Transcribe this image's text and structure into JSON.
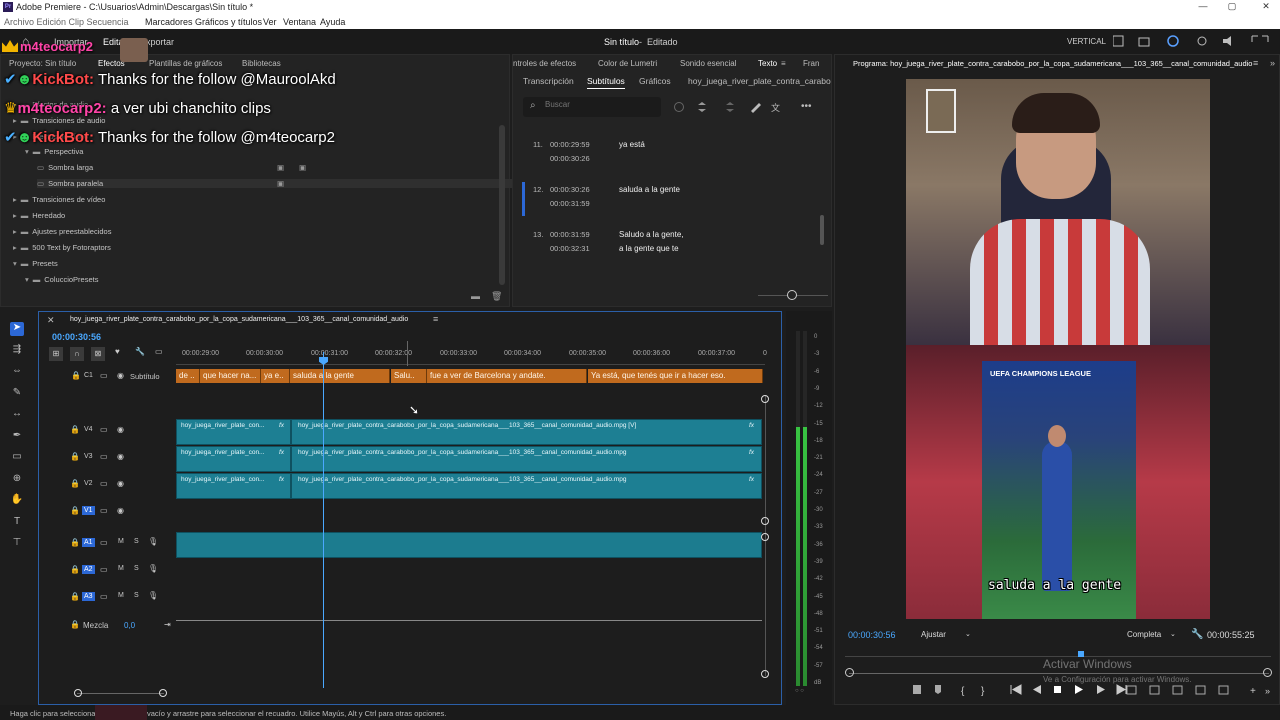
{
  "window": {
    "title": "Adobe Premiere - C:\\Usuarios\\Admin\\Descargas\\Sin título *",
    "min": "—",
    "max": "▢",
    "close": "✕"
  },
  "menu": [
    "Marcadores",
    "Gráficos y títulos",
    "Ver",
    "Ventana",
    "Ayuda"
  ],
  "menu_partial": "Archivo  Edición  Clip  Secuencia",
  "appbar": {
    "home": "⌂",
    "importar": "Importar",
    "editar": "Editar",
    "exportar": "Exportar",
    "project_title": "Sin título",
    "project_mode": "Editado",
    "vertical": "VERTICAL"
  },
  "overlay": {
    "top_user": "m4teocarp2",
    "lines": [
      {
        "user": "KickBot:",
        "text": " Thanks for the follow @MauroolAkd"
      },
      {
        "user": "m4teocarp2:",
        "text": " a ver ubi chanchito clips"
      },
      {
        "user": "KickBot:",
        "text": " Thanks for the follow @m4teocarp2"
      }
    ]
  },
  "left_panel": {
    "tabs": [
      "Proyecto: Sin título",
      "Efectos",
      "Plantillas de gráficos",
      "Bibliotecas"
    ],
    "tree": [
      {
        "label": "Efectos de audio",
        "indent": 0
      },
      {
        "label": "Transiciones de audio",
        "indent": 0
      },
      {
        "label": "Efectos de vídeo",
        "indent": 0
      },
      {
        "label": "Perspectiva",
        "indent": 1
      },
      {
        "label": "Sombra larga",
        "indent": 2
      },
      {
        "label": "Sombra paralela",
        "indent": 2
      },
      {
        "label": "Transiciones de vídeo",
        "indent": 0
      },
      {
        "label": "Heredado",
        "indent": 0
      },
      {
        "label": "Ajustes preestablecidos",
        "indent": 0
      },
      {
        "label": "500 Text by Fotoraptors",
        "indent": 0
      },
      {
        "label": "Presets",
        "indent": 0
      },
      {
        "label": "ColuccioPresets",
        "indent": 1
      }
    ]
  },
  "mid_panel": {
    "tabs_top": [
      "ntroles de efectos",
      "Color de Lumetri",
      "Sonido esencial",
      "Texto",
      "Fran"
    ],
    "tabs_sub": [
      "Transcripción",
      "Subtítulos",
      "Gráficos",
      "hoy_juega_river_plate_contra_carabo"
    ],
    "search_placeholder": "Buscar",
    "captions": [
      {
        "num": "11.",
        "start": "00:00:29:59",
        "end": "00:00:30:26",
        "text1": "ya está",
        "text2": ""
      },
      {
        "num": "12.",
        "start": "00:00:30:26",
        "end": "00:00:31:59",
        "text1": "saluda a la gente",
        "text2": ""
      },
      {
        "num": "13.",
        "start": "00:00:31:59",
        "end": "00:00:32:31",
        "text1": "Saludo a la gente,",
        "text2": "a la gente que te"
      }
    ]
  },
  "program": {
    "title": "Programa: hoy_juega_river_plate_contra_carabobo_por_la_copa_sudamericana___103_365__canal_comunidad_audio",
    "caption": "saluda a la gente",
    "ucl": "UEFA CHAMPIONS LEAGUE",
    "timecode": "00:00:30:56",
    "fit": "Ajustar",
    "quality": "Completa",
    "duration": "00:00:55:25",
    "watermark1": "Activar Windows",
    "watermark2": "Ve a Configuración para activar Windows."
  },
  "timeline": {
    "seq_name": "hoy_juega_river_plate_contra_carabobo_por_la_copa_sudamericana___103_365__canal_comunidad_audio",
    "timecode": "00:00:30:56",
    "ruler": [
      "00:00:29:00",
      "00:00:30:00",
      "00:00:31:00",
      "00:00:32:00",
      "00:00:33:00",
      "00:00:34:00",
      "00:00:35:00",
      "00:00:36:00",
      "00:00:37:00",
      "0"
    ],
    "caption_track": "Subtítulo",
    "caption_track_id": "C1",
    "caption_clips": [
      "de ..",
      "que hacer na...",
      "ya e..",
      "saluda a la gente",
      "Salu..",
      "fue a ver de Barcelona y andate.",
      "Ya está, que tenés que ir a hacer eso."
    ],
    "video_tracks": [
      {
        "id": "V4",
        "short": "hoy_juega_river_plate_con...",
        "long": "hoy_juega_river_plate_contra_carabobo_por_la_copa_sudamericana___103_365__canal_comunidad_audio.mpg [V]"
      },
      {
        "id": "V3",
        "short": "hoy_juega_river_plate_con...",
        "long": "hoy_juega_river_plate_contra_carabobo_por_la_copa_sudamericana___103_365__canal_comunidad_audio.mpg"
      },
      {
        "id": "V2",
        "short": "hoy_juega_river_plate_con...",
        "long": "hoy_juega_river_plate_contra_carabobo_por_la_copa_sudamericana___103_365__canal_comunidad_audio.mpg"
      },
      {
        "id": "V1",
        "short": "",
        "long": ""
      }
    ],
    "audio_tracks": [
      "A1",
      "A2",
      "A3"
    ],
    "mix_label": "Mezcla",
    "mix_value": "0,0",
    "fx": "fx"
  },
  "meter": [
    "0",
    "-3",
    "-6",
    "-9",
    "-12",
    "-15",
    "-18",
    "-21",
    "-24",
    "-27",
    "-30",
    "-33",
    "-36",
    "-39",
    "-42",
    "-45",
    "-48",
    "-51",
    "-54",
    "-57",
    "dB"
  ],
  "status": {
    "left": "Haga clic para seleccionar",
    "right": "vacío y arrastre para seleccionar el recuadro. Utilice Mayús, Alt y Ctrl para otras opciones."
  }
}
